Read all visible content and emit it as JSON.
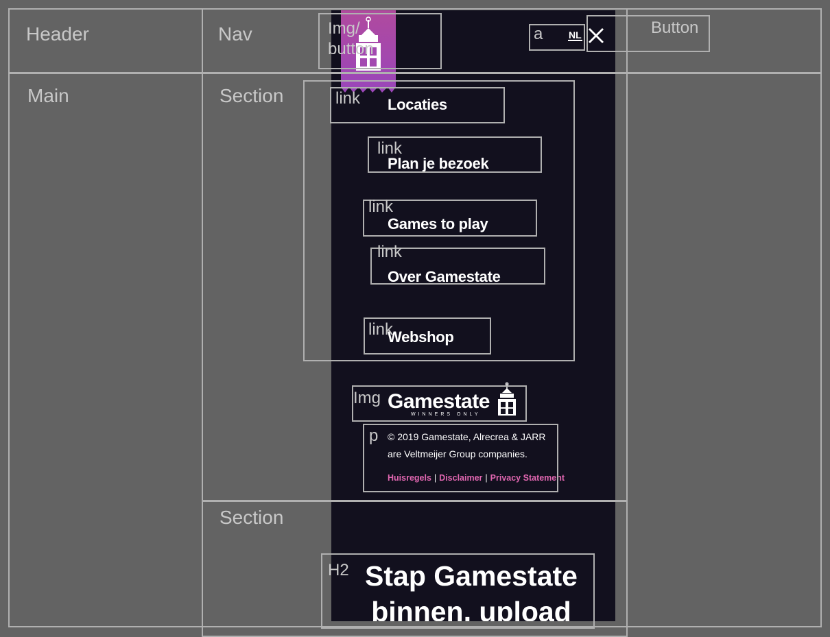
{
  "wireframe_labels": {
    "header": "Header",
    "nav": "Nav",
    "img_button": "Img/ button",
    "a": "a",
    "button": "Button",
    "main": "Main",
    "section1": "Section",
    "section2": "Section",
    "link": "link",
    "img": "Img",
    "p": "p",
    "h2": "H2"
  },
  "header": {
    "language": "NL",
    "close_icon": "close-icon"
  },
  "menu": {
    "items": [
      {
        "label": "Locaties"
      },
      {
        "label": "Plan je bezoek"
      },
      {
        "label": "Games to play"
      },
      {
        "label": "Over Gamestate"
      },
      {
        "label": "Webshop"
      }
    ]
  },
  "footer": {
    "brand": "Gamestate",
    "tagline": "WINNERS ONLY",
    "copyright": "© 2019 Gamestate, Alrecrea & JARR are Veltmeijer Group companies.",
    "links": [
      "Huisregels",
      "Disclaimer",
      "Privacy Statement"
    ]
  },
  "section2": {
    "heading": "Stap Gamestate binnen, upload"
  },
  "colors": {
    "page_background": "#636363",
    "panel_background": "#12101e",
    "accent_pink": "#e066b0",
    "logo_gradient_top": "#b04a9e",
    "logo_gradient_bottom": "#9b46b8",
    "wireframe_stroke": "#b0b0b0"
  }
}
